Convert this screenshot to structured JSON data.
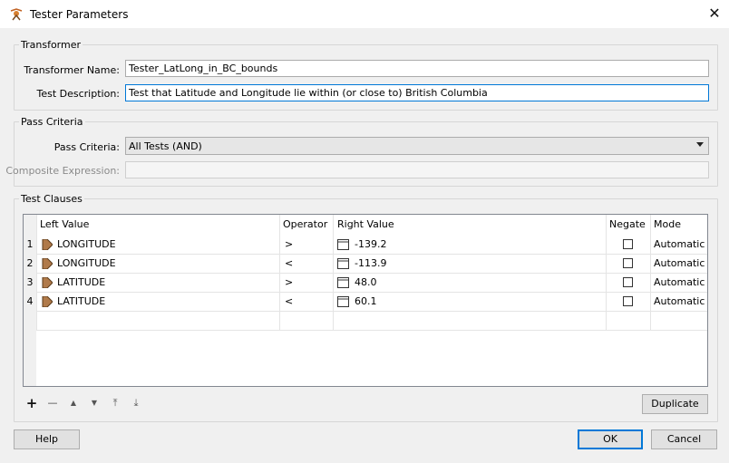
{
  "window": {
    "title": "Tester Parameters",
    "close_glyph": "✕",
    "icon": "tester-transformer-icon"
  },
  "transformer": {
    "group_label": "Transformer",
    "name_label": "Transformer Name:",
    "name_value": "Tester_LatLong_in_BC_bounds",
    "desc_label": "Test Description:",
    "desc_value": "Test that Latitude and Longitude lie within (or close to) British Columbia"
  },
  "pass_criteria": {
    "group_label": "Pass Criteria",
    "criteria_label": "Pass Criteria:",
    "criteria_value": "All Tests (AND)",
    "composite_label": "Composite Expression:",
    "composite_value": ""
  },
  "test_clauses": {
    "group_label": "Test Clauses",
    "columns": {
      "left": "Left Value",
      "operator": "Operator",
      "right": "Right Value",
      "negate": "Negate",
      "mode": "Mode"
    },
    "rows": [
      {
        "num": "1",
        "left": "LONGITUDE",
        "operator": ">",
        "right": "-139.2",
        "negate": false,
        "mode": "Automatic"
      },
      {
        "num": "2",
        "left": "LONGITUDE",
        "operator": "<",
        "right": "-113.9",
        "negate": false,
        "mode": "Automatic"
      },
      {
        "num": "3",
        "left": "LATITUDE",
        "operator": ">",
        "right": "48.0",
        "negate": false,
        "mode": "Automatic"
      },
      {
        "num": "4",
        "left": "LATITUDE",
        "operator": "<",
        "right": "60.1",
        "negate": false,
        "mode": "Automatic"
      }
    ],
    "toolbar": {
      "add": "+",
      "remove": "—",
      "up": "▲",
      "down": "▼",
      "top": "⤒",
      "bottom": "⤓"
    },
    "duplicate_label": "Duplicate"
  },
  "buttons": {
    "help": "Help",
    "ok": "OK",
    "cancel": "Cancel"
  },
  "colors": {
    "accent": "#0078d7",
    "attr_icon": "#b07a4a"
  }
}
